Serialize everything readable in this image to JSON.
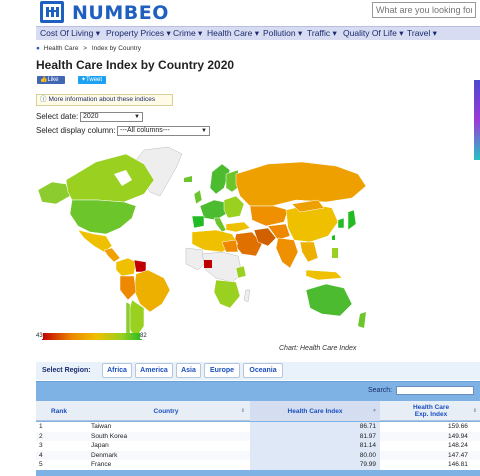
{
  "header": {
    "logo_text": "NUMBEO",
    "search_placeholder": "What are you looking for?"
  },
  "nav": {
    "items": [
      {
        "label": "Cost Of Living ▾"
      },
      {
        "label": "Property Prices ▾"
      },
      {
        "label": "Crime ▾"
      },
      {
        "label": "Health Care ▾"
      },
      {
        "label": "Pollution ▾"
      },
      {
        "label": "Traffic ▾"
      },
      {
        "label": "Quality Of Life ▾"
      },
      {
        "label": "Travel ▾"
      }
    ]
  },
  "breadcrumb": {
    "items": [
      {
        "label": "Health Care"
      },
      {
        "label": "Index by Country"
      }
    ],
    "separator": ">"
  },
  "page": {
    "title": "Health Care Index by Country 2020",
    "like_label": "Like",
    "tweet_label": "Tweet",
    "info_label": "More information about these indices"
  },
  "filters": {
    "date_label": "Select date:",
    "date_value": "2020",
    "column_label": "Select display column:",
    "column_value": "---All columns---"
  },
  "map": {
    "scale_min": "43",
    "scale_max": "82",
    "caption": "Chart: Health Care Index",
    "colors": {
      "high": "#22bb22",
      "mid_high": "#9ad020",
      "mid": "#eec000",
      "low": "#ee8800",
      "very_low": "#c00000",
      "no_data": "#e8e8e8"
    }
  },
  "regions": {
    "label": "Select Region:",
    "items": [
      {
        "label": "Africa"
      },
      {
        "label": "America"
      },
      {
        "label": "Asia"
      },
      {
        "label": "Europe"
      },
      {
        "label": "Oceania"
      }
    ]
  },
  "table": {
    "search_label": "Search:",
    "columns": {
      "rank": "Rank",
      "country": "Country",
      "hci": "Health Care Index",
      "exp1": "Health Care",
      "exp2": "Exp. Index"
    },
    "rows": [
      {
        "rank": "1",
        "country": "Taiwan",
        "hci": "86.71",
        "exp": "159.66"
      },
      {
        "rank": "2",
        "country": "South Korea",
        "hci": "81.97",
        "exp": "149.94"
      },
      {
        "rank": "3",
        "country": "Japan",
        "hci": "81.14",
        "exp": "148.24"
      },
      {
        "rank": "4",
        "country": "Denmark",
        "hci": "80.00",
        "exp": "147.47"
      },
      {
        "rank": "5",
        "country": "France",
        "hci": "79.99",
        "exp": "146.81"
      }
    ]
  }
}
